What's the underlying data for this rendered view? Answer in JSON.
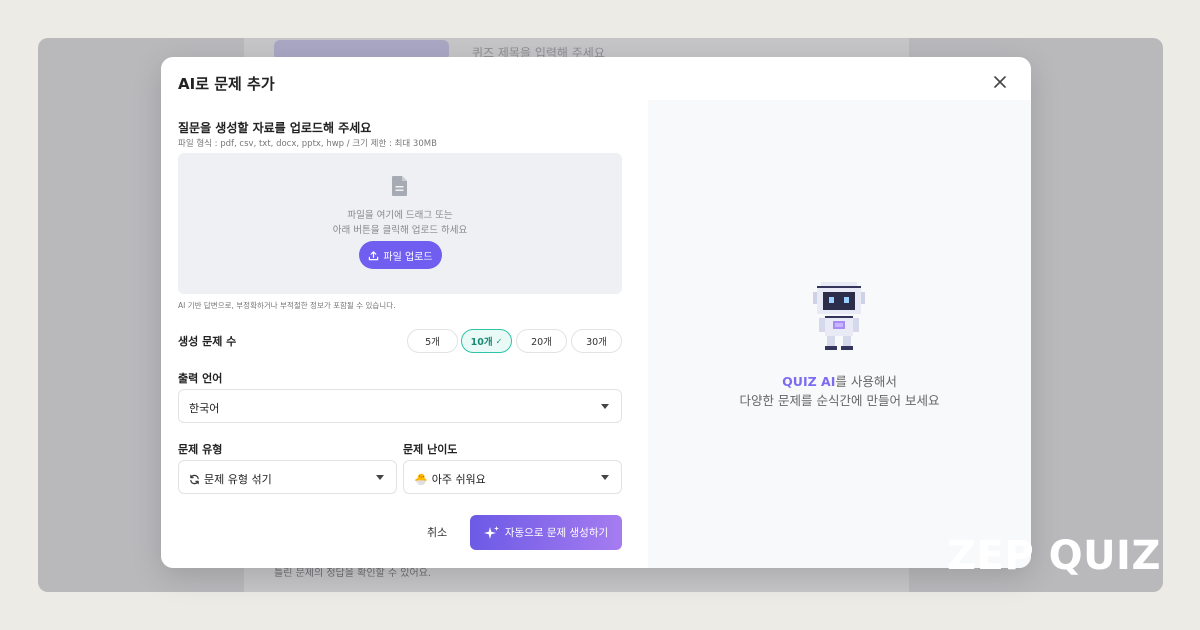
{
  "background": {
    "top_text": "퀴즈 제목을 입력해 주세요",
    "bottom_text": "틀린 문제의 정답을 확인할 수 있어요."
  },
  "modal": {
    "title": "AI로 문제 추가",
    "close_icon": "close-icon"
  },
  "upload": {
    "title": "질문을 생성할 자료를 업로드해 주세요",
    "hint": "파일 형식 : pdf, csv, txt, docx, pptx, hwp / 크기 제한 : 최대 30MB",
    "drop_text_1": "파일을 여기에 드래그 또는",
    "drop_text_2": "아래 버튼을 클릭해 업로드 하세요",
    "button_label": "파일 업로드",
    "disclaimer": "AI 기반 답변으로, 부정확하거나 부적절한 정보가 포함될 수 있습니다."
  },
  "question_count": {
    "label": "생성 문제 수",
    "options": [
      "5개",
      "10개",
      "20개",
      "30개"
    ],
    "selected": "10개",
    "check": "✓"
  },
  "language": {
    "label": "출력 언어",
    "value": "한국어"
  },
  "question_type": {
    "label": "문제 유형",
    "value": "문제 유형 섞기"
  },
  "difficulty": {
    "label": "문제 난이도",
    "icon": "🐣",
    "value": "아주 쉬워요"
  },
  "actions": {
    "cancel": "취소",
    "generate": "자동으로 문제 생성하기"
  },
  "promo": {
    "brand": "QUIZ AI",
    "line1_rest": "를 사용해서",
    "line2": "다양한 문제를 순식간에 만들어 보세요"
  },
  "logo": "ZEP QUIZ",
  "colors": {
    "accent": "#6f5ef0",
    "selected_chip": "#2ec4a8",
    "promo_brand": "#7b6cf0"
  }
}
